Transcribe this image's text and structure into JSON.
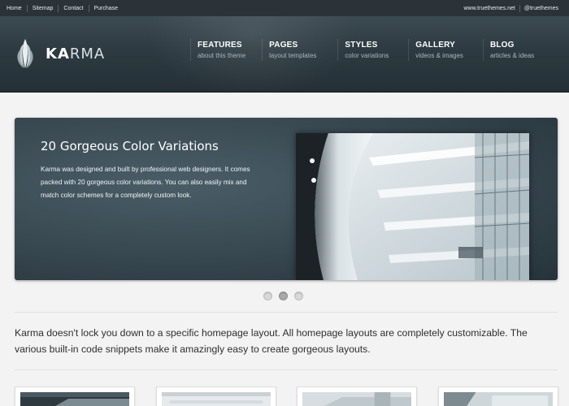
{
  "topbar": {
    "links": [
      "Home",
      "Sitemap",
      "Contact",
      "Purchase"
    ],
    "right_links": [
      "www.truethemes.net",
      "@truethemes"
    ]
  },
  "logo": {
    "bold": "KA",
    "rest": "RMA"
  },
  "nav": [
    {
      "title": "FEATURES",
      "subtitle": "about this theme"
    },
    {
      "title": "PAGES",
      "subtitle": "layout templates"
    },
    {
      "title": "STYLES",
      "subtitle": "color variations"
    },
    {
      "title": "GALLERY",
      "subtitle": "videos & images"
    },
    {
      "title": "BLOG",
      "subtitle": "articles & ideas"
    }
  ],
  "slider": {
    "title": "20 Gorgeous Color Variations",
    "text": "Karma was designed and built by professional web designers. It comes packed with 20 gorgeous color variations. You can also easily mix and match color schemes for a completely custom look.",
    "dots": 3,
    "active_dot": 2
  },
  "intro": "Karma doesn't lock you down to a specific homepage layout. All homepage layouts are completely customizable. The various built-in code snippets make it amazingly easy to create gorgeous layouts.",
  "colors": {
    "topbar_bg": "#2b3338",
    "header_bg": "#2d3a41",
    "slider_bg": "#37474f",
    "page_bg": "#f3f3f3"
  }
}
